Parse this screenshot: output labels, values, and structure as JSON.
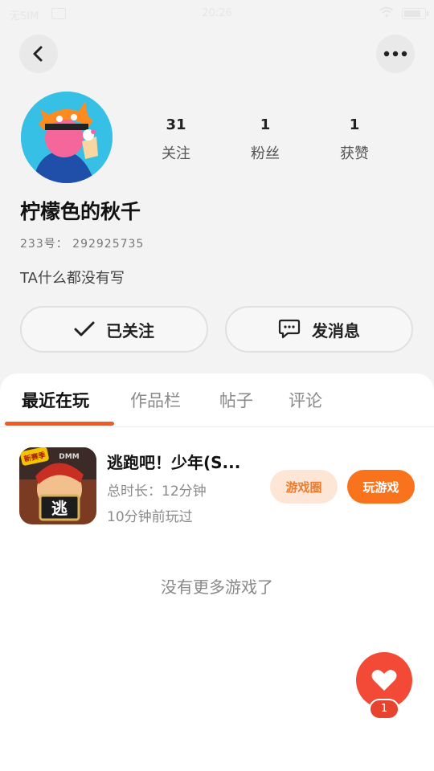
{
  "status_bar": {
    "carrier": "无SIM",
    "time": "20:26"
  },
  "profile": {
    "nickname": "柠檬色的秋千",
    "id_line": "233号：  292925735",
    "bio": "TA什么都没有写",
    "stats": [
      {
        "value": "31",
        "label": "关注"
      },
      {
        "value": "1",
        "label": "粉丝"
      },
      {
        "value": "1",
        "label": "获赞"
      }
    ]
  },
  "actions": {
    "follow_label": "已关注",
    "message_label": "发消息"
  },
  "tabs": [
    {
      "label": "最近在玩",
      "active": true
    },
    {
      "label": "作品栏",
      "active": false
    },
    {
      "label": "帖子",
      "active": false
    },
    {
      "label": "评论",
      "active": false
    }
  ],
  "games": [
    {
      "title": "逃跑吧！少年(S...",
      "duration": "总时长：12分钟",
      "last_played": "10分钟前玩过",
      "icon_badge": "新赛季",
      "icon_char": "逃",
      "icon_tag": "DMM",
      "circle_label": "游戏圈",
      "play_label": "玩游戏"
    }
  ],
  "empty_note": "没有更多游戏了",
  "like_count": "1",
  "colors": {
    "accent": "#f8731c",
    "tab_underline": "#f15a22",
    "fab": "#f24a36"
  }
}
